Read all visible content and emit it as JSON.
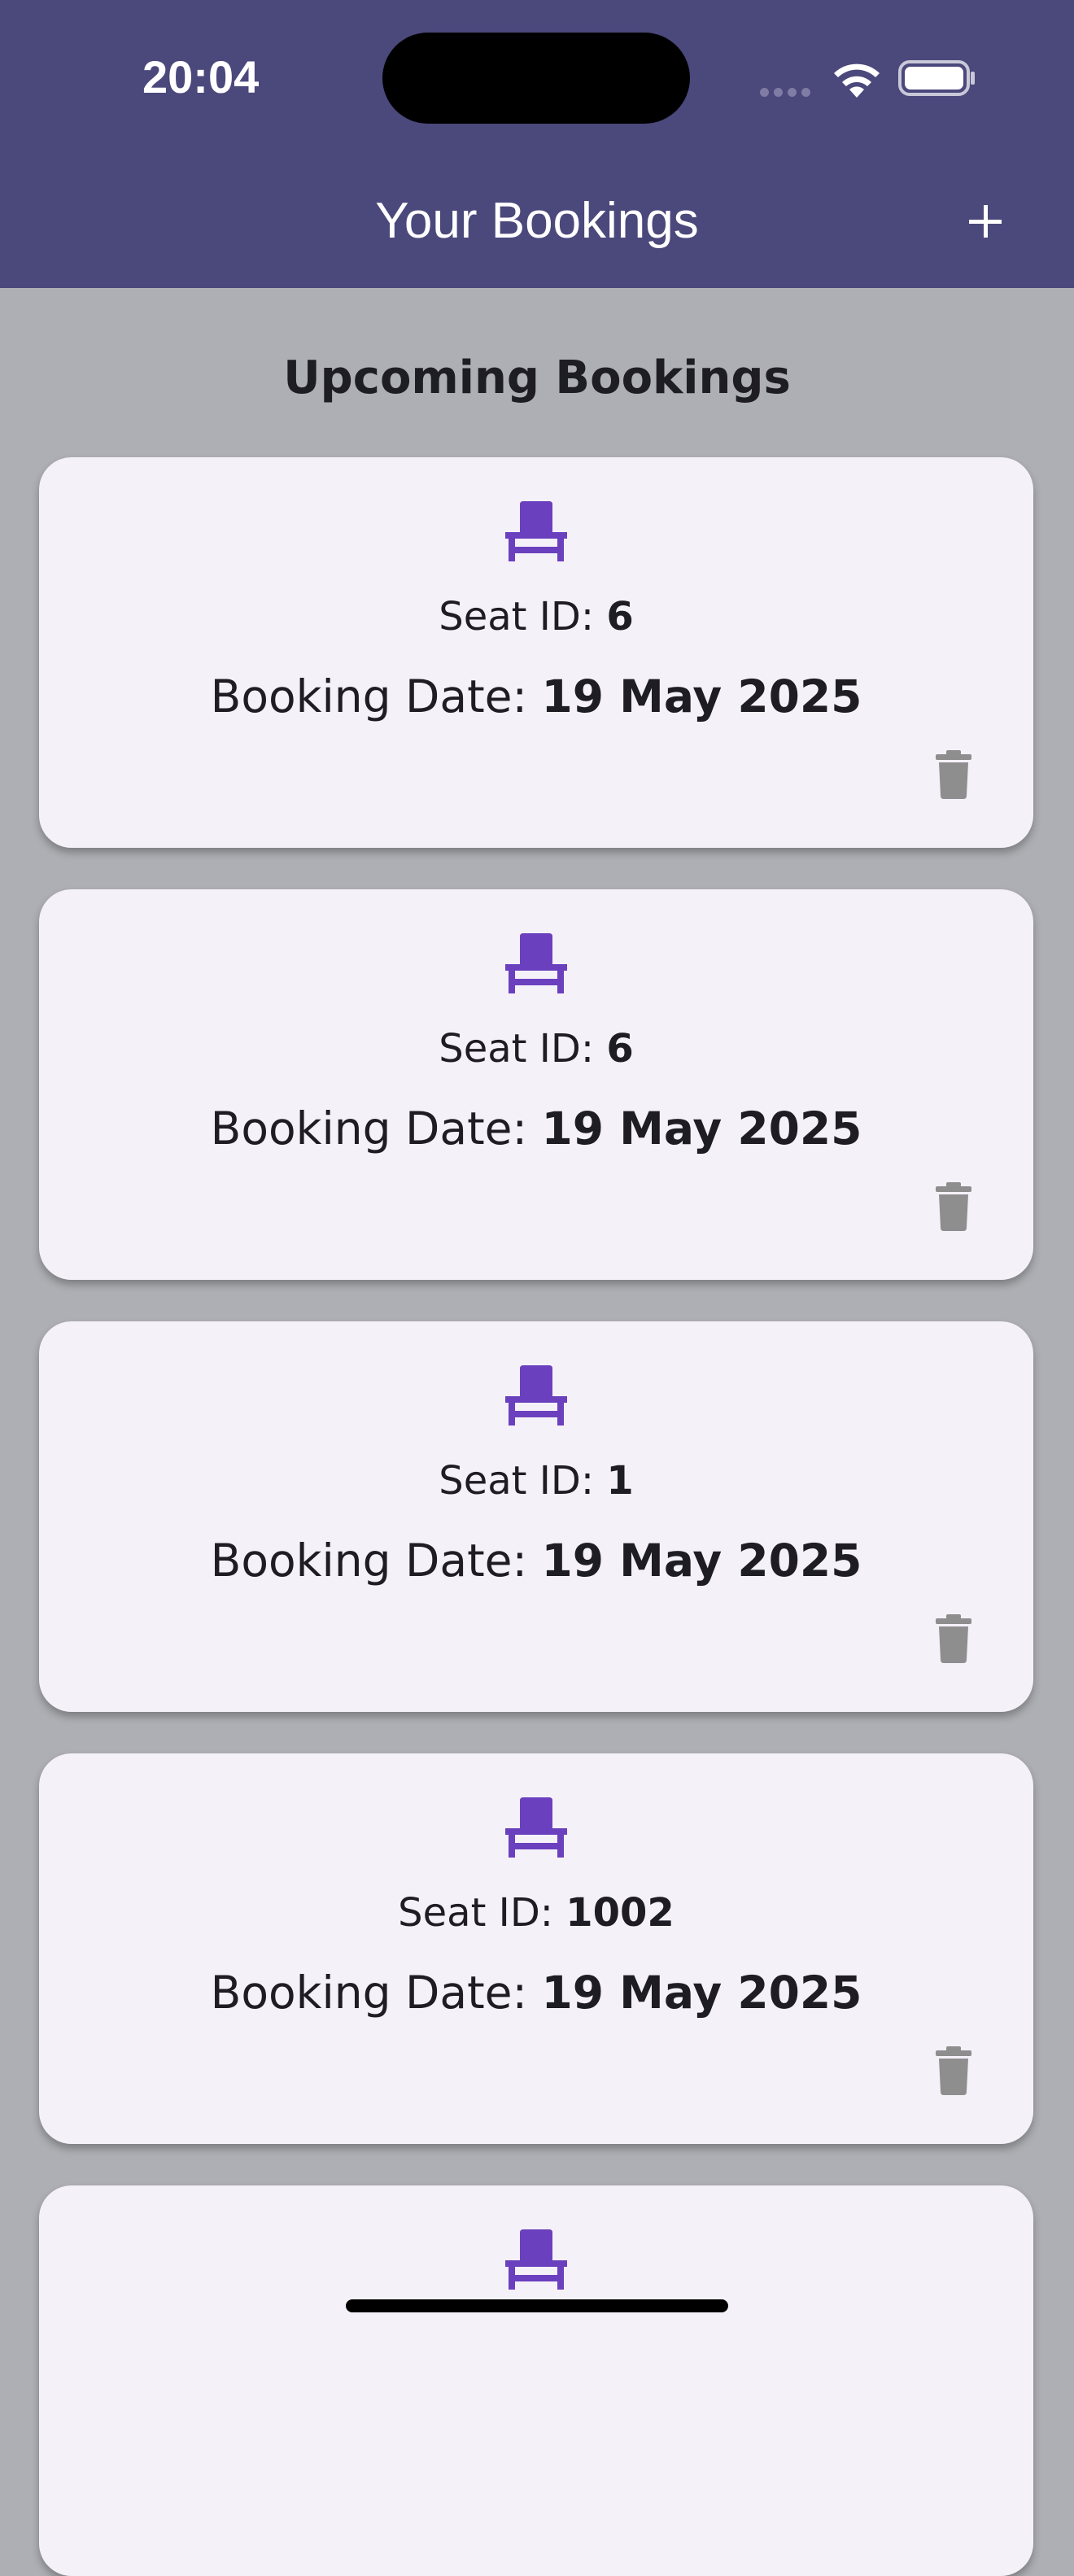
{
  "status_bar": {
    "time": "20:04"
  },
  "header": {
    "title": "Your Bookings",
    "add_icon": "plus-icon"
  },
  "section": {
    "title": "Upcoming Bookings"
  },
  "labels": {
    "seat": "Seat ID: ",
    "date": "Booking Date: "
  },
  "bookings": [
    {
      "seat_id": "6",
      "date": "19 May 2025"
    },
    {
      "seat_id": "6",
      "date": "19 May 2025"
    },
    {
      "seat_id": "1",
      "date": "19 May 2025"
    },
    {
      "seat_id": "1002",
      "date": "19 May 2025"
    },
    {
      "seat_id": "",
      "date": ""
    }
  ],
  "colors": {
    "app_bar": "#4B487C",
    "background": "#AEAFB4",
    "card": "#F5F1F9",
    "seat_icon": "#6B40BE",
    "delete_icon": "#8E8E8E"
  },
  "icons": {
    "seat": "seat-icon",
    "delete": "trash-icon"
  }
}
